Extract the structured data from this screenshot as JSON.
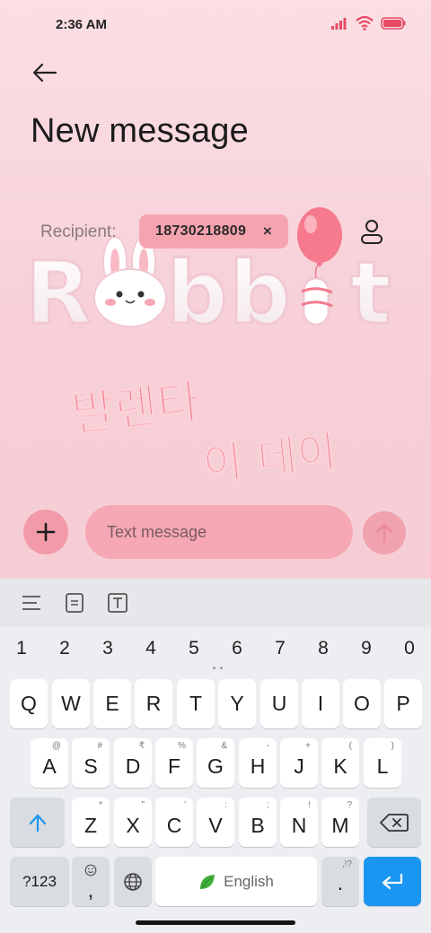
{
  "status_bar": {
    "time": "2:36 AM",
    "icons": [
      "signal-icon",
      "wifi-icon",
      "battery-icon"
    ],
    "battery_color": "#e94a63"
  },
  "header": {
    "back_icon": "back-arrow-icon",
    "title": "New message"
  },
  "recipient": {
    "label": "Recipient:",
    "chip_value": "18730218809",
    "chip_remove": "×",
    "contact_icon": "person-icon"
  },
  "wallpaper": {
    "word": "Rabbit",
    "korean_line1": "발렌타",
    "korean_line2": "이 데이",
    "accent_color": "#f3798b"
  },
  "compose": {
    "attach_icon": "plus-icon",
    "placeholder": "Text message",
    "value": "",
    "send_icon": "arrow-up-icon",
    "bubble_color": "#f5a7b4"
  },
  "keyboard": {
    "toolbar_icons": [
      "menu-lines-icon",
      "clipboard-icon",
      "text-format-icon"
    ],
    "numbers": [
      "1",
      "2",
      "3",
      "4",
      "5",
      "6",
      "7",
      "8",
      "9",
      "0"
    ],
    "row1": [
      "Q",
      "W",
      "E",
      "R",
      "T",
      "Y",
      "U",
      "I",
      "O",
      "P"
    ],
    "row2": [
      "A",
      "S",
      "D",
      "F",
      "G",
      "H",
      "J",
      "K",
      "L"
    ],
    "row2_hints": [
      "@",
      "#",
      "₹",
      "%",
      "&",
      "-",
      "+",
      "(",
      ")"
    ],
    "row3": [
      "Z",
      "X",
      "C",
      "V",
      "B",
      "N",
      "M"
    ],
    "row3_hints": [
      "*",
      "\"",
      "'",
      ":",
      ";",
      "!",
      "?"
    ],
    "symbols_label": "?123",
    "comma_label": ",",
    "space_label": "English",
    "period_label": ".",
    "period_hint": ",!?",
    "shift_icon": "shift-arrow-icon",
    "backspace_icon": "backspace-icon",
    "emoji_icon": "emoji-icon",
    "globe_icon": "globe-icon",
    "enter_icon": "enter-arrow-icon",
    "enter_color": "#1a96f2"
  }
}
